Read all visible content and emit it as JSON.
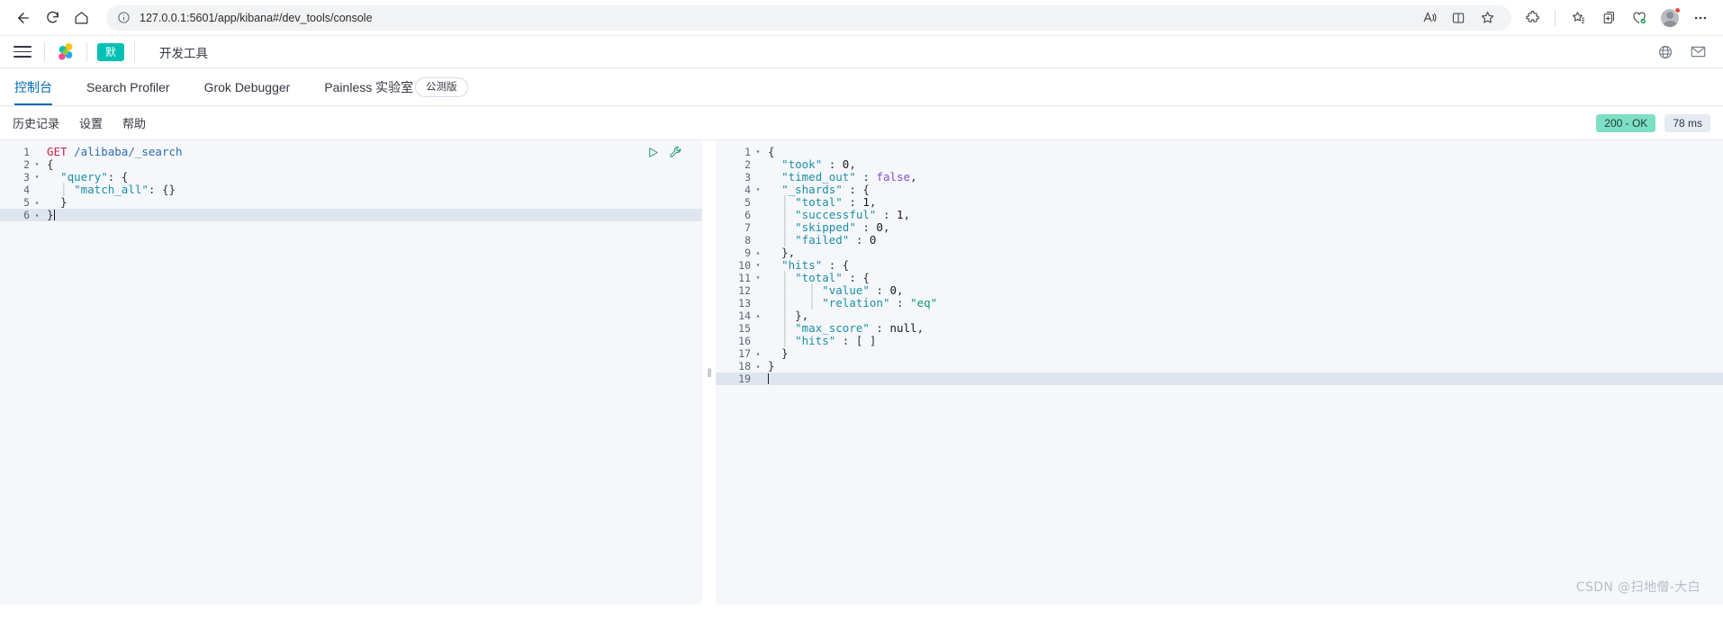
{
  "browser": {
    "back_label": "Back",
    "refresh_label": "Refresh",
    "home_label": "Home",
    "url_host": "127.0.0.1",
    "url_rest": ":5601/app/kibana#/dev_tools/console",
    "url_full": "127.0.0.1:5601/app/kibana#/dev_tools/console",
    "icons": {
      "info": "info-icon",
      "read_aloud": "read-aloud-icon",
      "split_screen": "split-screen-icon",
      "favorite": "star-icon",
      "extensions": "extensions-icon",
      "collections": "collections-icon",
      "add_tab": "add-tab-icon",
      "browser_essentials": "browser-essentials-icon",
      "profile": "avatar-icon",
      "settings_more": "more-options-icon"
    }
  },
  "kibana_header": {
    "menu_label": "Menu",
    "logo_label": "Elastic",
    "space_badge": "默",
    "app_title": "开发工具",
    "right_icons": [
      "globe-icon",
      "mail-icon"
    ]
  },
  "tabs": [
    {
      "label": "控制台",
      "active": true
    },
    {
      "label": "Search Profiler",
      "active": false
    },
    {
      "label": "Grok Debugger",
      "active": false
    },
    {
      "label": "Painless 实验室",
      "active": false,
      "badge": "公测版"
    }
  ],
  "console_toolbar": {
    "links": [
      "历史记录",
      "设置",
      "帮助"
    ],
    "status_code": "200 - OK",
    "elapsed": "78 ms",
    "status_color": "#7ddfc3"
  },
  "request_editor": {
    "actions": {
      "play": "play-icon",
      "wrench": "wrench-icon"
    },
    "current_line": 6,
    "lines": [
      {
        "n": 1,
        "fold": "",
        "tokens": [
          {
            "t": "GET",
            "c": "t-method"
          },
          {
            "t": " ",
            "c": "t-punct"
          },
          {
            "t": "/alibaba/_search",
            "c": "t-url"
          }
        ]
      },
      {
        "n": 2,
        "fold": "▾",
        "tokens": [
          {
            "t": "{",
            "c": "t-punct"
          }
        ]
      },
      {
        "n": 3,
        "fold": "▾",
        "tokens": [
          {
            "t": "  ",
            "c": "t-punct"
          },
          {
            "t": "\"query\"",
            "c": "t-key"
          },
          {
            "t": ": {",
            "c": "t-punct"
          }
        ]
      },
      {
        "n": 4,
        "fold": "",
        "tokens": [
          {
            "t": "  │ ",
            "c": "t-guide"
          },
          {
            "t": "\"match_all\"",
            "c": "t-key"
          },
          {
            "t": ": {}",
            "c": "t-punct"
          }
        ]
      },
      {
        "n": 5,
        "fold": "▴",
        "tokens": [
          {
            "t": "  }",
            "c": "t-punct"
          }
        ]
      },
      {
        "n": 6,
        "fold": "▴",
        "tokens": [
          {
            "t": "}",
            "c": "t-punct"
          }
        ]
      }
    ]
  },
  "response_viewer": {
    "lines": [
      {
        "n": 1,
        "fold": "▾",
        "tokens": [
          {
            "t": "{",
            "c": "t-punct"
          }
        ]
      },
      {
        "n": 2,
        "fold": "",
        "tokens": [
          {
            "t": "  ",
            "c": "t-punct"
          },
          {
            "t": "\"took\"",
            "c": "t-key"
          },
          {
            "t": " : ",
            "c": "t-punct"
          },
          {
            "t": "0",
            "c": "t-num"
          },
          {
            "t": ",",
            "c": "t-punct"
          }
        ]
      },
      {
        "n": 3,
        "fold": "",
        "tokens": [
          {
            "t": "  ",
            "c": "t-punct"
          },
          {
            "t": "\"timed_out\"",
            "c": "t-key"
          },
          {
            "t": " : ",
            "c": "t-punct"
          },
          {
            "t": "false",
            "c": "t-bool"
          },
          {
            "t": ",",
            "c": "t-punct"
          }
        ]
      },
      {
        "n": 4,
        "fold": "▾",
        "tokens": [
          {
            "t": "  ",
            "c": "t-punct"
          },
          {
            "t": "\"_shards\"",
            "c": "t-key"
          },
          {
            "t": " : {",
            "c": "t-punct"
          }
        ]
      },
      {
        "n": 5,
        "fold": "",
        "tokens": [
          {
            "t": "  │ ",
            "c": "t-guide"
          },
          {
            "t": "\"total\"",
            "c": "t-key"
          },
          {
            "t": " : ",
            "c": "t-punct"
          },
          {
            "t": "1",
            "c": "t-num"
          },
          {
            "t": ",",
            "c": "t-punct"
          }
        ]
      },
      {
        "n": 6,
        "fold": "",
        "tokens": [
          {
            "t": "  │ ",
            "c": "t-guide"
          },
          {
            "t": "\"successful\"",
            "c": "t-key"
          },
          {
            "t": " : ",
            "c": "t-punct"
          },
          {
            "t": "1",
            "c": "t-num"
          },
          {
            "t": ",",
            "c": "t-punct"
          }
        ]
      },
      {
        "n": 7,
        "fold": "",
        "tokens": [
          {
            "t": "  │ ",
            "c": "t-guide"
          },
          {
            "t": "\"skipped\"",
            "c": "t-key"
          },
          {
            "t": " : ",
            "c": "t-punct"
          },
          {
            "t": "0",
            "c": "t-num"
          },
          {
            "t": ",",
            "c": "t-punct"
          }
        ]
      },
      {
        "n": 8,
        "fold": "",
        "tokens": [
          {
            "t": "  │ ",
            "c": "t-guide"
          },
          {
            "t": "\"failed\"",
            "c": "t-key"
          },
          {
            "t": " : ",
            "c": "t-punct"
          },
          {
            "t": "0",
            "c": "t-num"
          }
        ]
      },
      {
        "n": 9,
        "fold": "▴",
        "tokens": [
          {
            "t": "  },",
            "c": "t-punct"
          }
        ]
      },
      {
        "n": 10,
        "fold": "▾",
        "tokens": [
          {
            "t": "  ",
            "c": "t-punct"
          },
          {
            "t": "\"hits\"",
            "c": "t-key"
          },
          {
            "t": " : {",
            "c": "t-punct"
          }
        ]
      },
      {
        "n": 11,
        "fold": "▾",
        "tokens": [
          {
            "t": "  │ ",
            "c": "t-guide"
          },
          {
            "t": "\"total\"",
            "c": "t-key"
          },
          {
            "t": " : {",
            "c": "t-punct"
          }
        ]
      },
      {
        "n": 12,
        "fold": "",
        "tokens": [
          {
            "t": "  │   │ ",
            "c": "t-guide"
          },
          {
            "t": "\"value\"",
            "c": "t-key"
          },
          {
            "t": " : ",
            "c": "t-punct"
          },
          {
            "t": "0",
            "c": "t-num"
          },
          {
            "t": ",",
            "c": "t-punct"
          }
        ]
      },
      {
        "n": 13,
        "fold": "",
        "tokens": [
          {
            "t": "  │   │ ",
            "c": "t-guide"
          },
          {
            "t": "\"relation\"",
            "c": "t-key"
          },
          {
            "t": " : ",
            "c": "t-punct"
          },
          {
            "t": "\"eq\"",
            "c": "t-str"
          }
        ]
      },
      {
        "n": 14,
        "fold": "▴",
        "tokens": [
          {
            "t": "  │ ",
            "c": "t-guide"
          },
          {
            "t": "},",
            "c": "t-punct"
          }
        ]
      },
      {
        "n": 15,
        "fold": "",
        "tokens": [
          {
            "t": "  │ ",
            "c": "t-guide"
          },
          {
            "t": "\"max_score\"",
            "c": "t-key"
          },
          {
            "t": " : ",
            "c": "t-punct"
          },
          {
            "t": "null",
            "c": "t-null"
          },
          {
            "t": ",",
            "c": "t-punct"
          }
        ]
      },
      {
        "n": 16,
        "fold": "",
        "tokens": [
          {
            "t": "  │ ",
            "c": "t-guide"
          },
          {
            "t": "\"hits\"",
            "c": "t-key"
          },
          {
            "t": " : [ ]",
            "c": "t-punct"
          }
        ]
      },
      {
        "n": 17,
        "fold": "▴",
        "tokens": [
          {
            "t": "  }",
            "c": "t-punct"
          }
        ]
      },
      {
        "n": 18,
        "fold": "▴",
        "tokens": [
          {
            "t": "}",
            "c": "t-punct"
          }
        ]
      },
      {
        "n": 19,
        "fold": "",
        "tokens": [
          {
            "t": "",
            "c": "t-punct"
          }
        ]
      }
    ],
    "current_line": 19
  },
  "watermark": "CSDN @扫地僧-大白"
}
